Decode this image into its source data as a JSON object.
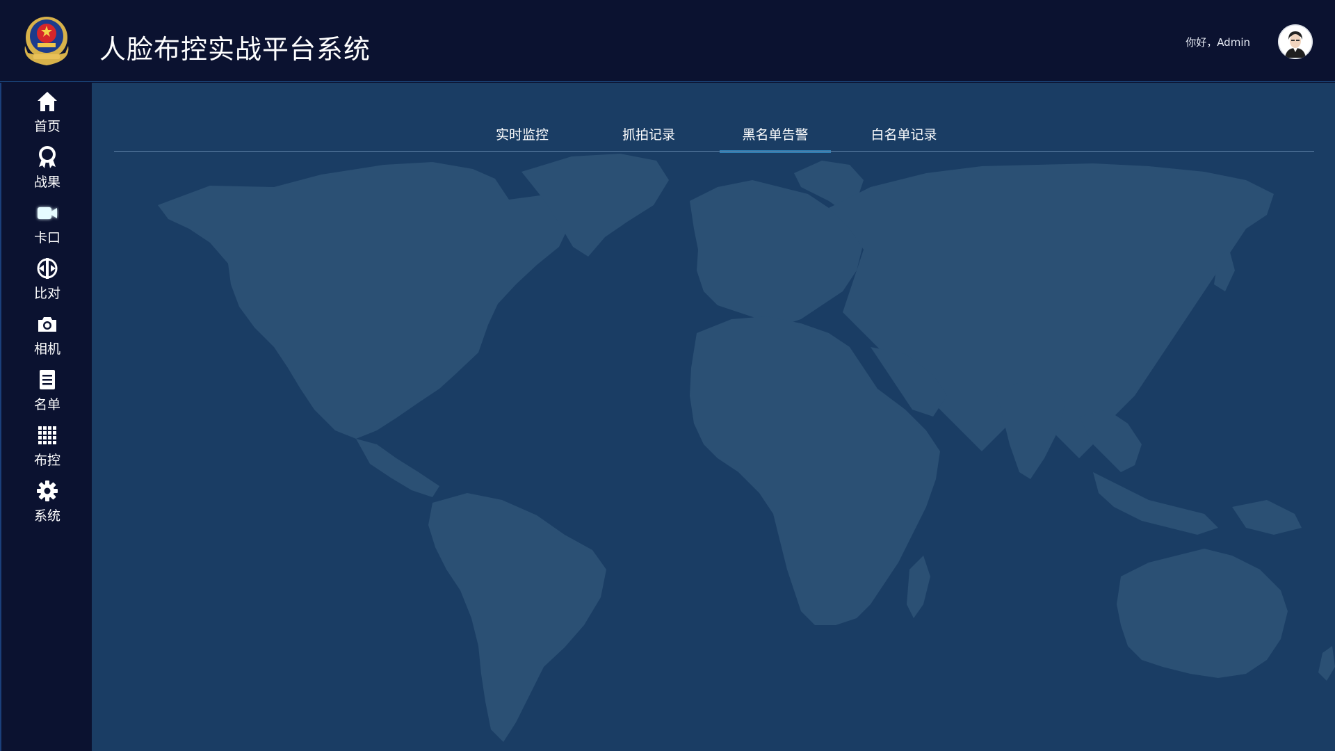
{
  "header": {
    "title": "人脸布控实战平台系统",
    "greeting": "你好，Admin",
    "emblem_icon": "police-emblem-icon",
    "avatar_icon": "user-avatar-icon"
  },
  "sidebar": {
    "items": [
      {
        "label": "首页",
        "icon": "home-icon"
      },
      {
        "label": "战果",
        "icon": "award-icon"
      },
      {
        "label": "卡口",
        "icon": "video-camera-icon",
        "active": true
      },
      {
        "label": "比对",
        "icon": "compare-icon"
      },
      {
        "label": "相机",
        "icon": "camera-icon"
      },
      {
        "label": "名单",
        "icon": "document-icon"
      },
      {
        "label": "布控",
        "icon": "grid-icon"
      },
      {
        "label": "系统",
        "icon": "gear-icon"
      }
    ]
  },
  "main": {
    "tabs": [
      {
        "label": "实时监控",
        "active": false
      },
      {
        "label": "抓拍记录",
        "active": false
      },
      {
        "label": "黑名单告警",
        "active": true
      },
      {
        "label": "白名单记录",
        "active": false
      }
    ],
    "background": "world-map-icon"
  },
  "colors": {
    "header_bg": "#0b1230",
    "main_bg": "#1a3d64",
    "map_land": "#2b5074",
    "active_tab_underline": "#2f7fb3",
    "active_icon_glow": "#7fe7ff"
  }
}
